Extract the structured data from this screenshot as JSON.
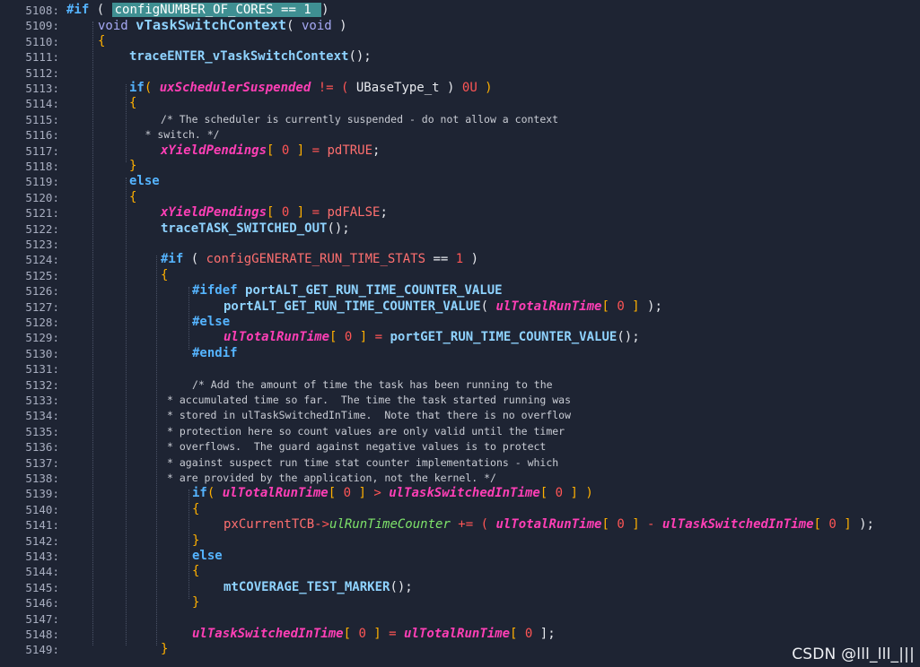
{
  "lines": [
    {
      "n": "5108:",
      "i": 0,
      "t": [
        [
          "#if",
          "pp"
        ],
        [
          " ( ",
          "plain"
        ],
        [
          "configNUMBER_OF_CORES == 1 ",
          "hl"
        ],
        [
          ")",
          "plain"
        ]
      ]
    },
    {
      "n": "5109:",
      "i": 1,
      "t": [
        [
          "void",
          "kw"
        ],
        [
          " ",
          "plain"
        ],
        [
          "vTaskSwitchContext",
          "fnbig"
        ],
        [
          "( ",
          "plain"
        ],
        [
          "void",
          "kw"
        ],
        [
          " )",
          "plain"
        ]
      ]
    },
    {
      "n": "5110:",
      "i": 1,
      "t": [
        [
          "{",
          "br"
        ]
      ]
    },
    {
      "n": "5111:",
      "i": 2,
      "t": [
        [
          "traceENTER_vTaskSwitchContext",
          "fn"
        ],
        [
          "();",
          "plain"
        ]
      ]
    },
    {
      "n": "5112:",
      "i": 2,
      "t": []
    },
    {
      "n": "5113:",
      "i": 2,
      "t": [
        [
          "if",
          "pp"
        ],
        [
          "( ",
          "br"
        ],
        [
          "uxSchedulerSuspended",
          "var"
        ],
        [
          " != ( ",
          "op"
        ],
        [
          "UBaseType_t",
          "plain"
        ],
        [
          " ) ",
          "plain"
        ],
        [
          "0U",
          "num"
        ],
        [
          " )",
          "br"
        ]
      ]
    },
    {
      "n": "5114:",
      "i": 2,
      "t": [
        [
          "{",
          "br"
        ]
      ]
    },
    {
      "n": "5115:",
      "i": 3,
      "t": [
        [
          "/* The scheduler is currently suspended - do not allow a context",
          "cm"
        ]
      ]
    },
    {
      "n": "5116:",
      "i": 2.5,
      "t": [
        [
          "* switch. */",
          "cm"
        ]
      ]
    },
    {
      "n": "5117:",
      "i": 3,
      "t": [
        [
          "xYieldPendings",
          "var"
        ],
        [
          "[ ",
          "br"
        ],
        [
          "0",
          "num"
        ],
        [
          " ]",
          "br"
        ],
        [
          " = ",
          "op"
        ],
        [
          "pdTRUE",
          "macro"
        ],
        [
          ";",
          "plain"
        ]
      ]
    },
    {
      "n": "5118:",
      "i": 2,
      "t": [
        [
          "}",
          "br"
        ]
      ]
    },
    {
      "n": "5119:",
      "i": 2,
      "t": [
        [
          "else",
          "pp"
        ]
      ]
    },
    {
      "n": "5120:",
      "i": 2,
      "t": [
        [
          "{",
          "br"
        ]
      ]
    },
    {
      "n": "5121:",
      "i": 3,
      "t": [
        [
          "xYieldPendings",
          "var"
        ],
        [
          "[ ",
          "br"
        ],
        [
          "0",
          "num"
        ],
        [
          " ]",
          "br"
        ],
        [
          " = ",
          "op"
        ],
        [
          "pdFALSE",
          "macro"
        ],
        [
          ";",
          "plain"
        ]
      ]
    },
    {
      "n": "5122:",
      "i": 3,
      "t": [
        [
          "traceTASK_SWITCHED_OUT",
          "fn"
        ],
        [
          "();",
          "plain"
        ]
      ]
    },
    {
      "n": "5123:",
      "i": 3,
      "t": []
    },
    {
      "n": "5124:",
      "i": 3,
      "t": [
        [
          "#if",
          "pp"
        ],
        [
          " ( ",
          "plain"
        ],
        [
          "configGENERATE_RUN_TIME_STATS",
          "macro"
        ],
        [
          " == ",
          "plain"
        ],
        [
          "1",
          "num"
        ],
        [
          " )",
          "plain"
        ]
      ]
    },
    {
      "n": "5125:",
      "i": 3,
      "t": [
        [
          "{",
          "br"
        ]
      ]
    },
    {
      "n": "5126:",
      "i": 4,
      "t": [
        [
          "#ifdef",
          "pp"
        ],
        [
          " ",
          "plain"
        ],
        [
          "portALT_GET_RUN_TIME_COUNTER_VALUE",
          "fn"
        ]
      ]
    },
    {
      "n": "5127:",
      "i": 5,
      "t": [
        [
          "portALT_GET_RUN_TIME_COUNTER_VALUE",
          "fn"
        ],
        [
          "( ",
          "plain"
        ],
        [
          "ulTotalRunTime",
          "var"
        ],
        [
          "[ ",
          "br"
        ],
        [
          "0",
          "num"
        ],
        [
          " ]",
          "br"
        ],
        [
          " );",
          "plain"
        ]
      ]
    },
    {
      "n": "5128:",
      "i": 4,
      "t": [
        [
          "#else",
          "pp"
        ]
      ]
    },
    {
      "n": "5129:",
      "i": 5,
      "t": [
        [
          "ulTotalRunTime",
          "var"
        ],
        [
          "[ ",
          "br"
        ],
        [
          "0",
          "num"
        ],
        [
          " ]",
          "br"
        ],
        [
          " = ",
          "op"
        ],
        [
          "portGET_RUN_TIME_COUNTER_VALUE",
          "fn"
        ],
        [
          "();",
          "plain"
        ]
      ]
    },
    {
      "n": "5130:",
      "i": 4,
      "t": [
        [
          "#endif",
          "pp"
        ]
      ]
    },
    {
      "n": "5131:",
      "i": 4,
      "t": []
    },
    {
      "n": "5132:",
      "i": 4,
      "t": [
        [
          "/* Add the amount of time the task has been running to the",
          "cm"
        ]
      ]
    },
    {
      "n": "5133:",
      "i": 3.2,
      "t": [
        [
          "* accumulated time so far.  The time the task started running was",
          "cm"
        ]
      ]
    },
    {
      "n": "5134:",
      "i": 3.2,
      "t": [
        [
          "* stored in ulTaskSwitchedInTime.  Note that there is no overflow",
          "cm"
        ]
      ]
    },
    {
      "n": "5135:",
      "i": 3.2,
      "t": [
        [
          "* protection here so count values are only valid until the timer",
          "cm"
        ]
      ]
    },
    {
      "n": "5136:",
      "i": 3.2,
      "t": [
        [
          "* overflows.  The guard against negative values is to protect",
          "cm"
        ]
      ]
    },
    {
      "n": "5137:",
      "i": 3.2,
      "t": [
        [
          "* against suspect run time stat counter implementations - which",
          "cm"
        ]
      ]
    },
    {
      "n": "5138:",
      "i": 3.2,
      "t": [
        [
          "* are provided by the application, not the kernel. */",
          "cm"
        ]
      ]
    },
    {
      "n": "5139:",
      "i": 4,
      "t": [
        [
          "if",
          "pp"
        ],
        [
          "( ",
          "br"
        ],
        [
          "ulTotalRunTime",
          "var"
        ],
        [
          "[ ",
          "br"
        ],
        [
          "0",
          "num"
        ],
        [
          " ]",
          "br"
        ],
        [
          " > ",
          "op"
        ],
        [
          "ulTaskSwitchedInTime",
          "var"
        ],
        [
          "[ ",
          "br"
        ],
        [
          "0",
          "num"
        ],
        [
          " ]",
          "br"
        ],
        [
          " )",
          "br"
        ]
      ]
    },
    {
      "n": "5140:",
      "i": 4,
      "t": [
        [
          "{",
          "br"
        ]
      ]
    },
    {
      "n": "5141:",
      "i": 5,
      "t": [
        [
          "pxCurrentTCB",
          "macro"
        ],
        [
          "->",
          "op"
        ],
        [
          "ulRunTimeCounter",
          "member"
        ],
        [
          " += ( ",
          "op"
        ],
        [
          "ulTotalRunTime",
          "var"
        ],
        [
          "[ ",
          "br"
        ],
        [
          "0",
          "num"
        ],
        [
          " ]",
          "br"
        ],
        [
          " - ",
          "op"
        ],
        [
          "ulTaskSwitchedInTime",
          "var"
        ],
        [
          "[ ",
          "br"
        ],
        [
          "0",
          "num"
        ],
        [
          " ]",
          "br"
        ],
        [
          " );",
          "plain"
        ]
      ]
    },
    {
      "n": "5142:",
      "i": 4,
      "t": [
        [
          "}",
          "br"
        ]
      ]
    },
    {
      "n": "5143:",
      "i": 4,
      "t": [
        [
          "else",
          "pp"
        ]
      ]
    },
    {
      "n": "5144:",
      "i": 4,
      "t": [
        [
          "{",
          "br"
        ]
      ]
    },
    {
      "n": "5145:",
      "i": 5,
      "t": [
        [
          "mtCOVERAGE_TEST_MARKER",
          "fn"
        ],
        [
          "();",
          "plain"
        ]
      ]
    },
    {
      "n": "5146:",
      "i": 4,
      "t": [
        [
          "}",
          "br"
        ]
      ]
    },
    {
      "n": "5147:",
      "i": 4,
      "t": []
    },
    {
      "n": "5148:",
      "i": 4,
      "t": [
        [
          "ulTaskSwitchedInTime",
          "var"
        ],
        [
          "[ ",
          "br"
        ],
        [
          "0",
          "num"
        ],
        [
          " ]",
          "br"
        ],
        [
          " = ",
          "op"
        ],
        [
          "ulTotalRunTime",
          "var"
        ],
        [
          "[ ",
          "br"
        ],
        [
          "0",
          "num"
        ],
        [
          " ];",
          "plain"
        ]
      ]
    },
    {
      "n": "5149:",
      "i": 3,
      "t": [
        [
          "}",
          "br"
        ]
      ]
    }
  ],
  "colors": {
    "background": "#1e2433",
    "line_number": "#a8aec0",
    "preprocessor": "#55b4ff",
    "function": "#8fd3ff",
    "variable": "#ff3fb6",
    "macro": "#ff6f6f",
    "bracket": "#ffb000",
    "number": "#ff5555",
    "member": "#7ee26a",
    "comment": "#c9ccd4",
    "highlight": "#3f8f92"
  },
  "watermark": "CSDN @lll_lll_|||"
}
